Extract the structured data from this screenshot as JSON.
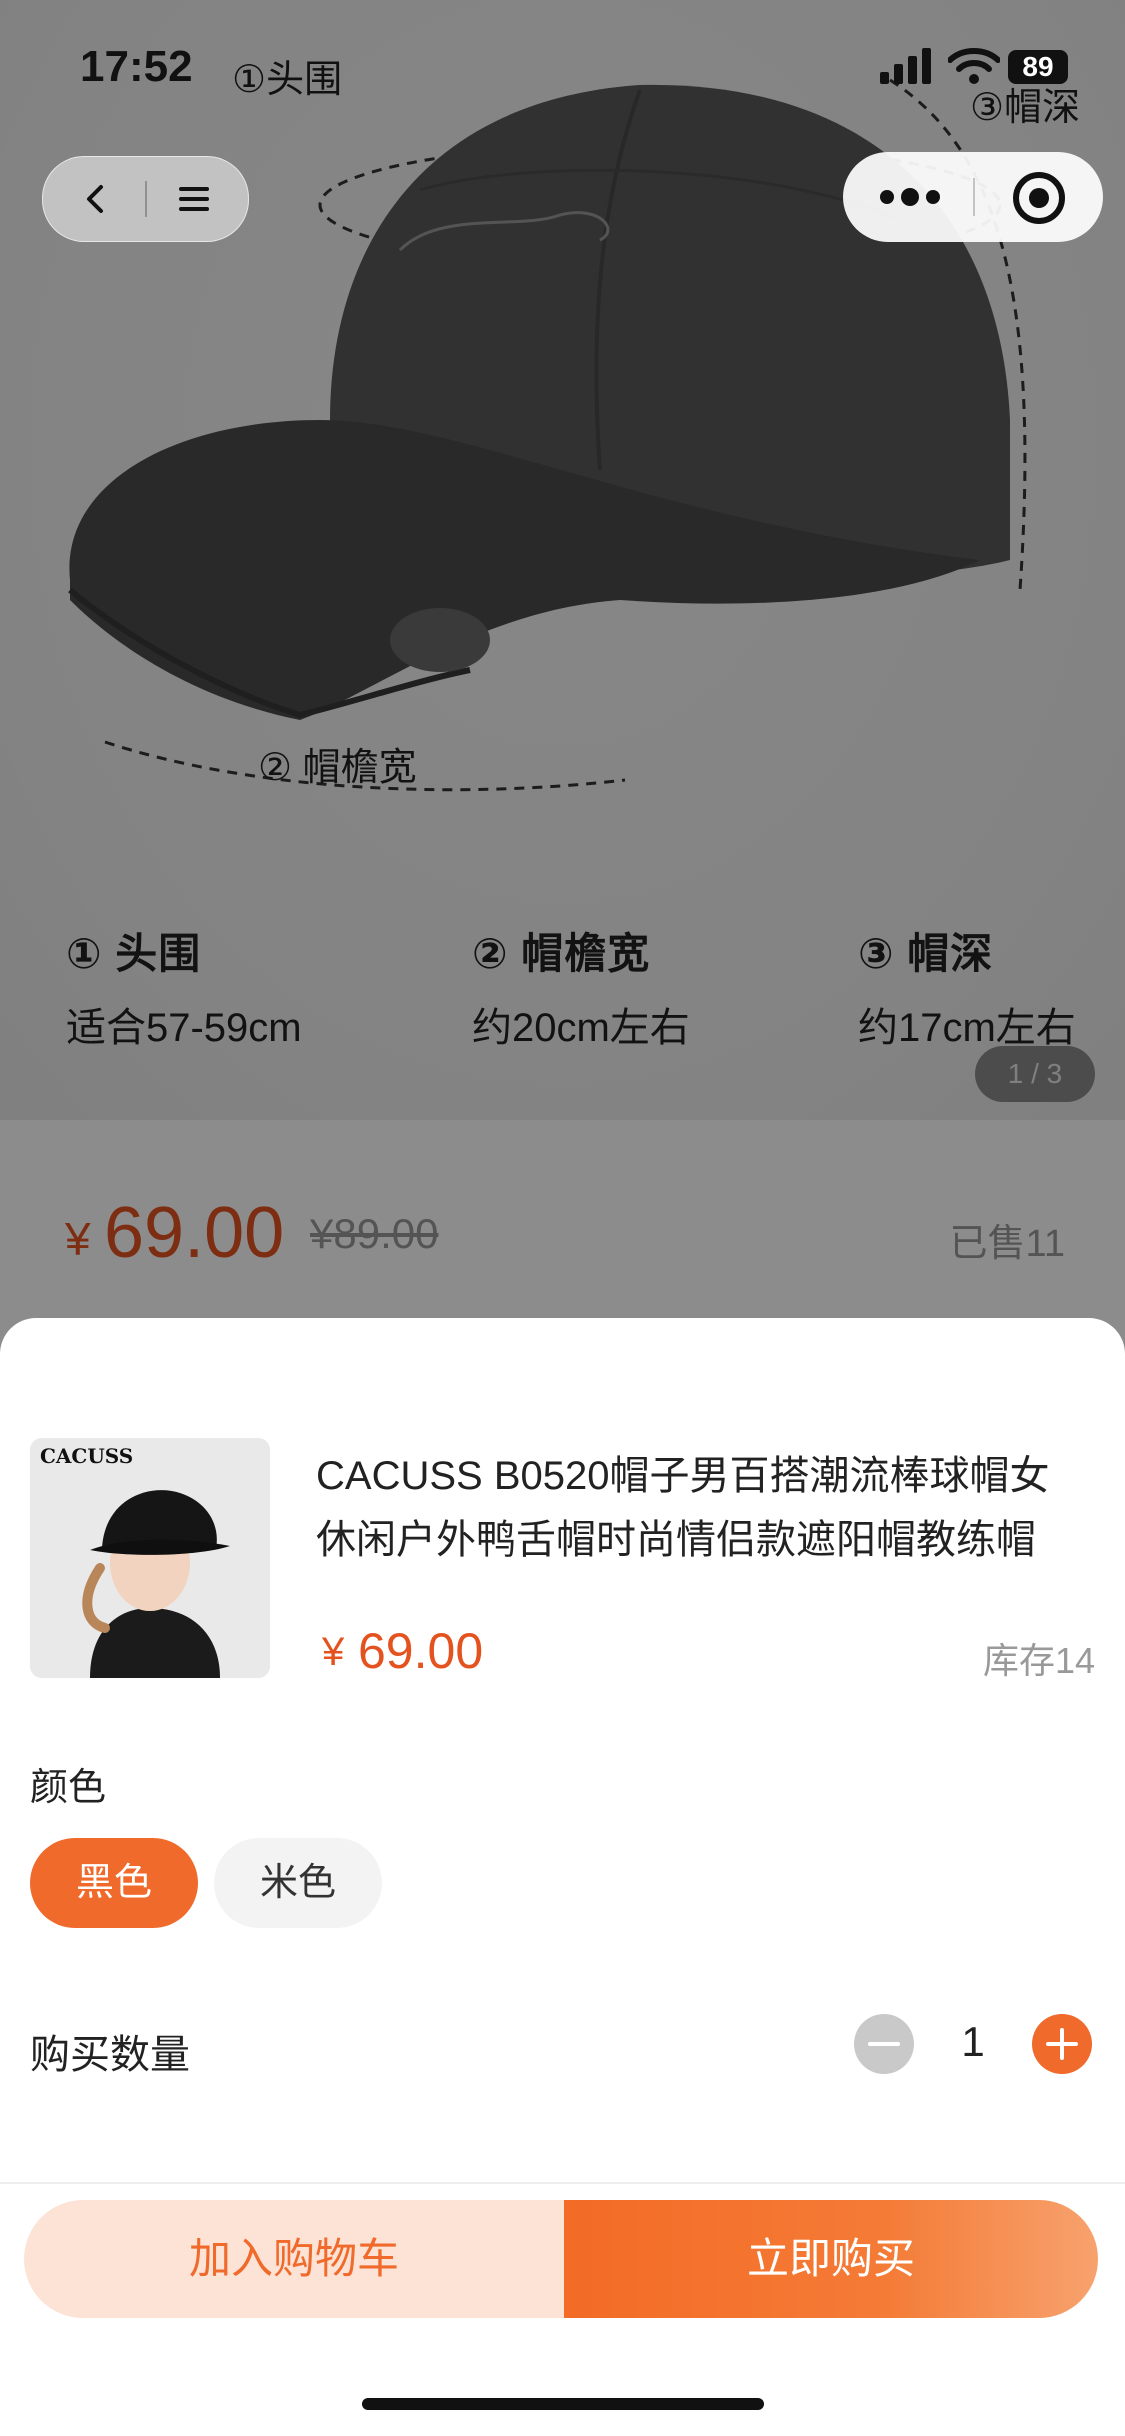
{
  "status_bar": {
    "time": "17:52",
    "note_left": "①头围",
    "note_right": "③帽深",
    "battery": "89"
  },
  "product_image": {
    "label_brim": "② 帽檐宽",
    "specs": [
      {
        "heading": "① 头围",
        "value": "适合57-59cm"
      },
      {
        "heading": "② 帽檐宽",
        "value": "约20cm左右"
      },
      {
        "heading": "③ 帽深",
        "value": "约17cm左右"
      }
    ],
    "page_indicator": "1 / 3"
  },
  "price_card": {
    "currency": "¥",
    "price": "69.00",
    "original_price": "¥89.00",
    "sold": "已售11"
  },
  "sheet": {
    "thumb_brand": "CACUSS",
    "title": "CACUSS B0520帽子男百搭潮流棒球帽女休闲户外鸭舌帽时尚情侣款遮阳帽教练帽",
    "currency": "¥",
    "price": "69.00",
    "stock": "库存14",
    "color_label": "颜色",
    "colors": [
      {
        "label": "黑色",
        "selected": true
      },
      {
        "label": "米色",
        "selected": false
      }
    ],
    "quantity_label": "购买数量",
    "quantity": "1",
    "add_to_cart": "加入购物车",
    "buy_now": "立即购买"
  },
  "theme": {
    "accent": "#f06a2b",
    "price_color": "#e4531f"
  }
}
